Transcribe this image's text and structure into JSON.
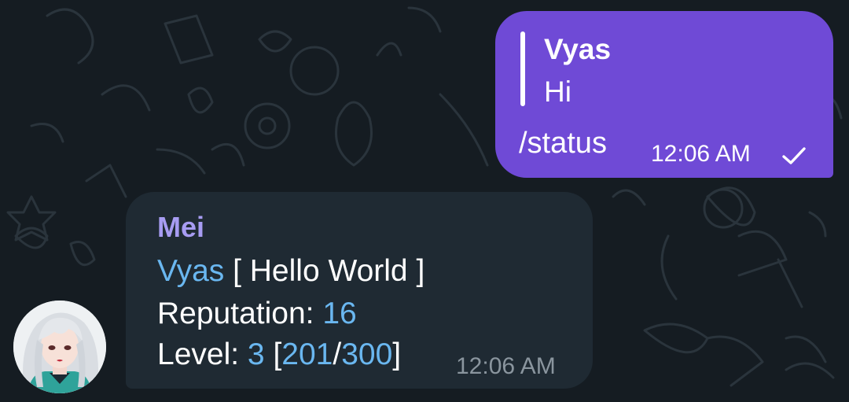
{
  "outgoing_message": {
    "reply": {
      "author": "Vyas",
      "text": "Hi"
    },
    "text": "/status",
    "time": "12:06 AM",
    "status_icon": "single-check-icon"
  },
  "incoming_message": {
    "sender": "Mei",
    "lines": {
      "line1": {
        "mention": "Vyas",
        "rest": " [ Hello World ]"
      },
      "line2": {
        "label": "Reputation: ",
        "value": "16"
      },
      "line3": {
        "label": "Level: ",
        "level": "3",
        "open": " [",
        "current": "201",
        "sep": "/",
        "max": "300",
        "close": "]"
      }
    },
    "time": "12:06 AM",
    "avatar": "anime-girl-avatar"
  },
  "colors": {
    "background": "#151c22",
    "outgoing_bubble": "#6f4ad6",
    "incoming_bubble": "#1f2a33",
    "sender_name": "#a79cf2",
    "link": "#6ab7f0",
    "incoming_time": "#8a959e"
  }
}
